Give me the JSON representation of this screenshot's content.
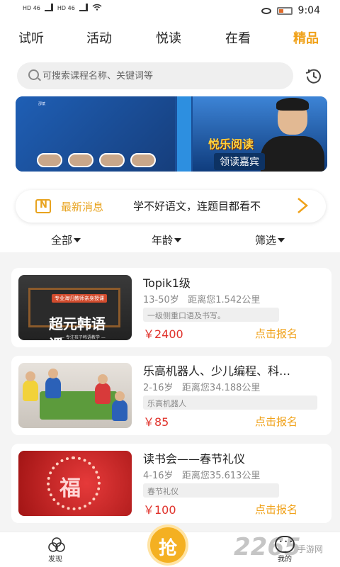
{
  "status_bar": {
    "sim1": "HD 46",
    "sim2": "HD 46",
    "time": "9:04"
  },
  "tabs": [
    {
      "label": "试听",
      "active": false
    },
    {
      "label": "活动",
      "active": false
    },
    {
      "label": "悦读",
      "active": false
    },
    {
      "label": "在看",
      "active": false
    },
    {
      "label": "精品",
      "active": true
    }
  ],
  "search": {
    "placeholder": "可搜索课程名称、关键词等",
    "icon": "search-icon",
    "history_icon": "history-clock-icon"
  },
  "banner": {
    "left_text": "邵斌",
    "logo_text": "悦乐阅读",
    "tag": "领读嘉宾"
  },
  "news": {
    "label": "最新消息",
    "text": "学不好语文，连题目都看不",
    "icon": "news-icon",
    "arrow_icon": "chevron-right-icon"
  },
  "filters": [
    {
      "label": "全部"
    },
    {
      "label": "年龄"
    },
    {
      "label": "筛选"
    }
  ],
  "courses": [
    {
      "title": "Topik1级",
      "age": "13-50岁",
      "distance": "距离您1.542公里",
      "tag": "一级侧重口语及书写。",
      "price": "￥2400",
      "cta": "点击报名",
      "image": {
        "banner": "专业海归教师亲身授课",
        "headline": "超元韩语课",
        "sub": "— 专注孩子韩语教学 —"
      }
    },
    {
      "title": "乐高机器人、少儿编程、科…",
      "age": "2-16岁",
      "distance": "距离您34.188公里",
      "tag": "乐高机器人",
      "price": "￥85",
      "cta": "点击报名"
    },
    {
      "title": "读书会——春节礼仪",
      "age": "4-16岁",
      "distance": "距离您35.613公里",
      "tag": "春节礼仪",
      "price": "￥100",
      "cta": "点击报名",
      "image": {
        "glyph": "福"
      }
    }
  ],
  "bottom_nav": {
    "discover": "发现",
    "center": "抢",
    "mine": "我的",
    "watermark": "2265",
    "watermark_sub": "手游网"
  },
  "colors": {
    "accent": "#f0a21a",
    "price": "#e0312a"
  }
}
